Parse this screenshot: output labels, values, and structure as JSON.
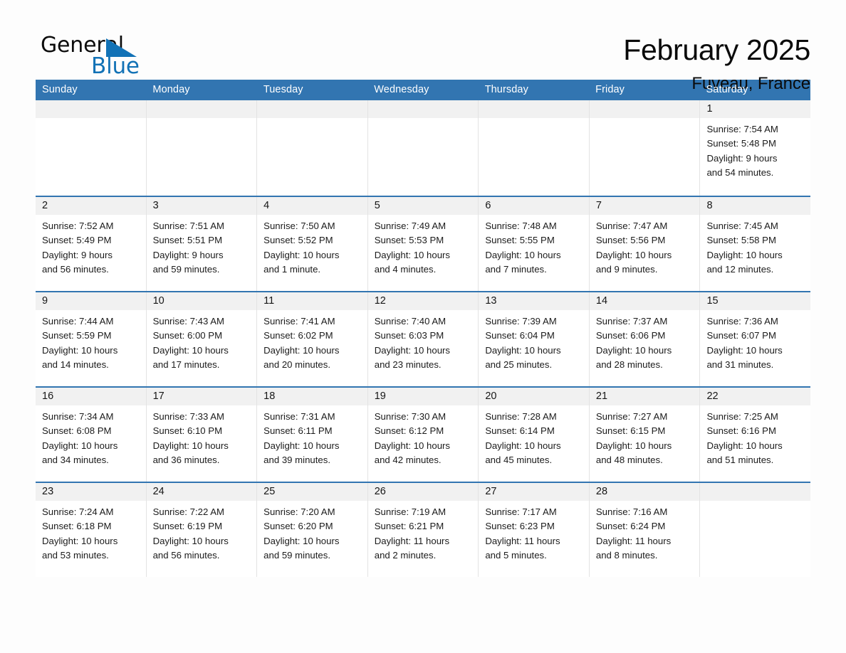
{
  "brand": {
    "name_part1": "General",
    "name_part2": "Blue",
    "accent_color": "#1272b6"
  },
  "header": {
    "title": "February 2025",
    "location": "Fuveau, France",
    "header_color": "#3275b1"
  },
  "weekdays": [
    "Sunday",
    "Monday",
    "Tuesday",
    "Wednesday",
    "Thursday",
    "Friday",
    "Saturday"
  ],
  "weeks": [
    [
      {
        "day": "",
        "sunrise": "",
        "sunset": "",
        "daylight": "",
        "daylight2": ""
      },
      {
        "day": "",
        "sunrise": "",
        "sunset": "",
        "daylight": "",
        "daylight2": ""
      },
      {
        "day": "",
        "sunrise": "",
        "sunset": "",
        "daylight": "",
        "daylight2": ""
      },
      {
        "day": "",
        "sunrise": "",
        "sunset": "",
        "daylight": "",
        "daylight2": ""
      },
      {
        "day": "",
        "sunrise": "",
        "sunset": "",
        "daylight": "",
        "daylight2": ""
      },
      {
        "day": "",
        "sunrise": "",
        "sunset": "",
        "daylight": "",
        "daylight2": ""
      },
      {
        "day": "1",
        "sunrise": "Sunrise: 7:54 AM",
        "sunset": "Sunset: 5:48 PM",
        "daylight": "Daylight: 9 hours",
        "daylight2": "and 54 minutes."
      }
    ],
    [
      {
        "day": "2",
        "sunrise": "Sunrise: 7:52 AM",
        "sunset": "Sunset: 5:49 PM",
        "daylight": "Daylight: 9 hours",
        "daylight2": "and 56 minutes."
      },
      {
        "day": "3",
        "sunrise": "Sunrise: 7:51 AM",
        "sunset": "Sunset: 5:51 PM",
        "daylight": "Daylight: 9 hours",
        "daylight2": "and 59 minutes."
      },
      {
        "day": "4",
        "sunrise": "Sunrise: 7:50 AM",
        "sunset": "Sunset: 5:52 PM",
        "daylight": "Daylight: 10 hours",
        "daylight2": "and 1 minute."
      },
      {
        "day": "5",
        "sunrise": "Sunrise: 7:49 AM",
        "sunset": "Sunset: 5:53 PM",
        "daylight": "Daylight: 10 hours",
        "daylight2": "and 4 minutes."
      },
      {
        "day": "6",
        "sunrise": "Sunrise: 7:48 AM",
        "sunset": "Sunset: 5:55 PM",
        "daylight": "Daylight: 10 hours",
        "daylight2": "and 7 minutes."
      },
      {
        "day": "7",
        "sunrise": "Sunrise: 7:47 AM",
        "sunset": "Sunset: 5:56 PM",
        "daylight": "Daylight: 10 hours",
        "daylight2": "and 9 minutes."
      },
      {
        "day": "8",
        "sunrise": "Sunrise: 7:45 AM",
        "sunset": "Sunset: 5:58 PM",
        "daylight": "Daylight: 10 hours",
        "daylight2": "and 12 minutes."
      }
    ],
    [
      {
        "day": "9",
        "sunrise": "Sunrise: 7:44 AM",
        "sunset": "Sunset: 5:59 PM",
        "daylight": "Daylight: 10 hours",
        "daylight2": "and 14 minutes."
      },
      {
        "day": "10",
        "sunrise": "Sunrise: 7:43 AM",
        "sunset": "Sunset: 6:00 PM",
        "daylight": "Daylight: 10 hours",
        "daylight2": "and 17 minutes."
      },
      {
        "day": "11",
        "sunrise": "Sunrise: 7:41 AM",
        "sunset": "Sunset: 6:02 PM",
        "daylight": "Daylight: 10 hours",
        "daylight2": "and 20 minutes."
      },
      {
        "day": "12",
        "sunrise": "Sunrise: 7:40 AM",
        "sunset": "Sunset: 6:03 PM",
        "daylight": "Daylight: 10 hours",
        "daylight2": "and 23 minutes."
      },
      {
        "day": "13",
        "sunrise": "Sunrise: 7:39 AM",
        "sunset": "Sunset: 6:04 PM",
        "daylight": "Daylight: 10 hours",
        "daylight2": "and 25 minutes."
      },
      {
        "day": "14",
        "sunrise": "Sunrise: 7:37 AM",
        "sunset": "Sunset: 6:06 PM",
        "daylight": "Daylight: 10 hours",
        "daylight2": "and 28 minutes."
      },
      {
        "day": "15",
        "sunrise": "Sunrise: 7:36 AM",
        "sunset": "Sunset: 6:07 PM",
        "daylight": "Daylight: 10 hours",
        "daylight2": "and 31 minutes."
      }
    ],
    [
      {
        "day": "16",
        "sunrise": "Sunrise: 7:34 AM",
        "sunset": "Sunset: 6:08 PM",
        "daylight": "Daylight: 10 hours",
        "daylight2": "and 34 minutes."
      },
      {
        "day": "17",
        "sunrise": "Sunrise: 7:33 AM",
        "sunset": "Sunset: 6:10 PM",
        "daylight": "Daylight: 10 hours",
        "daylight2": "and 36 minutes."
      },
      {
        "day": "18",
        "sunrise": "Sunrise: 7:31 AM",
        "sunset": "Sunset: 6:11 PM",
        "daylight": "Daylight: 10 hours",
        "daylight2": "and 39 minutes."
      },
      {
        "day": "19",
        "sunrise": "Sunrise: 7:30 AM",
        "sunset": "Sunset: 6:12 PM",
        "daylight": "Daylight: 10 hours",
        "daylight2": "and 42 minutes."
      },
      {
        "day": "20",
        "sunrise": "Sunrise: 7:28 AM",
        "sunset": "Sunset: 6:14 PM",
        "daylight": "Daylight: 10 hours",
        "daylight2": "and 45 minutes."
      },
      {
        "day": "21",
        "sunrise": "Sunrise: 7:27 AM",
        "sunset": "Sunset: 6:15 PM",
        "daylight": "Daylight: 10 hours",
        "daylight2": "and 48 minutes."
      },
      {
        "day": "22",
        "sunrise": "Sunrise: 7:25 AM",
        "sunset": "Sunset: 6:16 PM",
        "daylight": "Daylight: 10 hours",
        "daylight2": "and 51 minutes."
      }
    ],
    [
      {
        "day": "23",
        "sunrise": "Sunrise: 7:24 AM",
        "sunset": "Sunset: 6:18 PM",
        "daylight": "Daylight: 10 hours",
        "daylight2": "and 53 minutes."
      },
      {
        "day": "24",
        "sunrise": "Sunrise: 7:22 AM",
        "sunset": "Sunset: 6:19 PM",
        "daylight": "Daylight: 10 hours",
        "daylight2": "and 56 minutes."
      },
      {
        "day": "25",
        "sunrise": "Sunrise: 7:20 AM",
        "sunset": "Sunset: 6:20 PM",
        "daylight": "Daylight: 10 hours",
        "daylight2": "and 59 minutes."
      },
      {
        "day": "26",
        "sunrise": "Sunrise: 7:19 AM",
        "sunset": "Sunset: 6:21 PM",
        "daylight": "Daylight: 11 hours",
        "daylight2": "and 2 minutes."
      },
      {
        "day": "27",
        "sunrise": "Sunrise: 7:17 AM",
        "sunset": "Sunset: 6:23 PM",
        "daylight": "Daylight: 11 hours",
        "daylight2": "and 5 minutes."
      },
      {
        "day": "28",
        "sunrise": "Sunrise: 7:16 AM",
        "sunset": "Sunset: 6:24 PM",
        "daylight": "Daylight: 11 hours",
        "daylight2": "and 8 minutes."
      },
      {
        "day": "",
        "sunrise": "",
        "sunset": "",
        "daylight": "",
        "daylight2": ""
      }
    ]
  ]
}
